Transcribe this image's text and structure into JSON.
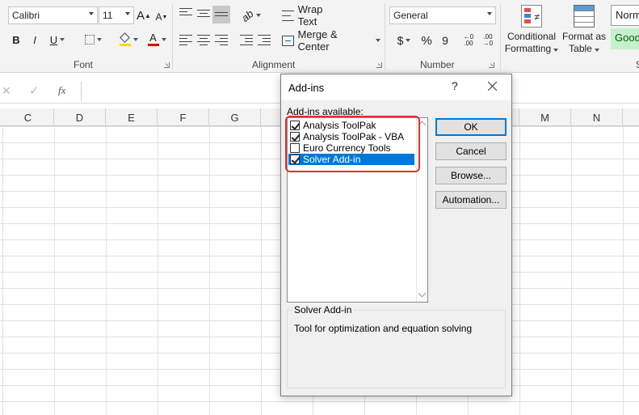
{
  "ribbon": {
    "font": {
      "family": "Calibri",
      "size": "11",
      "label": "Font",
      "bold": "B",
      "italic": "I",
      "underline": "U",
      "grow": "A",
      "shrink": "A",
      "font_color_letter": "A"
    },
    "alignment": {
      "wrap_text": "Wrap Text",
      "merge_center": "Merge & Center",
      "label": "Alignment"
    },
    "number": {
      "format": "General",
      "currency": "$",
      "percent": "%",
      "comma": "9",
      "inc_decimal": ".00",
      "dec_decimal": ".00",
      "label": "Number"
    },
    "styles": {
      "conditional_formatting_1": "Conditional",
      "conditional_formatting_2": "Formatting",
      "format_as_table_1": "Format as",
      "format_as_table_2": "Table",
      "normal_partial": "Norm",
      "good_partial": "Good",
      "styles_label_partial": "S"
    },
    "colors": {
      "highlight_yellow": "#ffd800",
      "font_red": "#e00000",
      "good_bg": "#c6efce",
      "good_fg": "#006100"
    }
  },
  "formula_bar": {
    "fx": "fx",
    "cancel_icon": "close-icon",
    "enter_icon": "check-icon"
  },
  "columns": [
    "C",
    "D",
    "E",
    "F",
    "G",
    "H",
    "I",
    "J",
    "K",
    "L",
    "M",
    "N"
  ],
  "dialog": {
    "title": "Add-ins",
    "help": "?",
    "available_label": "Add-ins available:",
    "items": [
      {
        "label": "Analysis ToolPak",
        "checked": true,
        "selected": false
      },
      {
        "label": "Analysis ToolPak - VBA",
        "checked": true,
        "selected": false
      },
      {
        "label": "Euro Currency Tools",
        "checked": false,
        "selected": false
      },
      {
        "label": "Solver Add-in",
        "checked": true,
        "selected": true
      }
    ],
    "buttons": {
      "ok": "OK",
      "cancel": "Cancel",
      "browse": "Browse...",
      "automation": "Automation..."
    },
    "description_title": "Solver Add-in",
    "description_text": "Tool for optimization and equation solving",
    "highlight_color": "#e03030",
    "selection_color": "#0078d7"
  }
}
